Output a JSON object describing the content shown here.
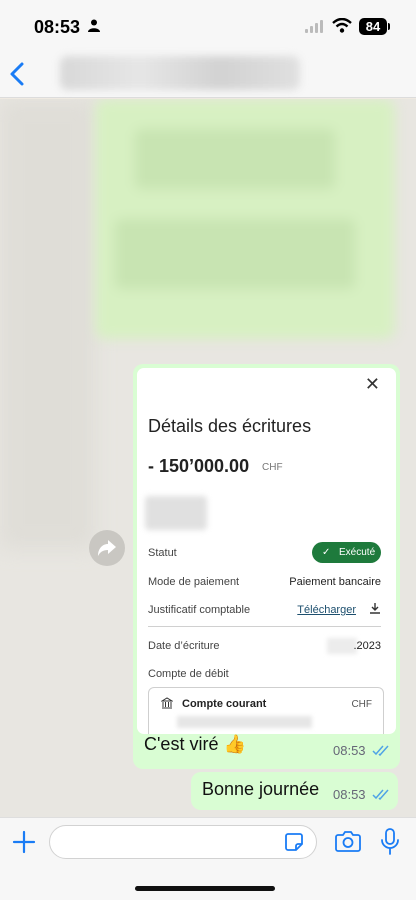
{
  "status_bar": {
    "time": "08:53",
    "battery": "84"
  },
  "chat": {
    "image_message": {
      "screenshot": {
        "title": "Détails des écritures",
        "amount": "- 150’000.00",
        "currency": "CHF",
        "rows": [
          {
            "label": "Statut",
            "value": "Exécuté"
          },
          {
            "label": "Mode de paiement",
            "value": "Paiement bancaire"
          },
          {
            "label": "Justificatif comptable",
            "value": "Télécharger"
          },
          {
            "label": "Date d’écriture",
            "value": ".2023"
          },
          {
            "label": "Compte de débit",
            "value": ""
          }
        ],
        "account": {
          "name": "Compte courant",
          "currency": "CHF"
        }
      },
      "caption": "C'est viré 👍",
      "time": "08:53"
    },
    "text_message": {
      "text": "Bonne journée",
      "time": "08:53"
    }
  },
  "colors": {
    "outgoing_bubble": "#d9fdd3",
    "accent": "#1a7cf5",
    "status_green": "#1e7a3c"
  },
  "icons": [
    "person-icon",
    "signal-icon",
    "wifi-icon",
    "back-chevron-icon",
    "forward-icon",
    "close-icon",
    "check-icon",
    "download-icon",
    "bank-icon",
    "read-ticks-icon",
    "plus-icon",
    "sticker-icon",
    "camera-icon",
    "microphone-icon"
  ]
}
